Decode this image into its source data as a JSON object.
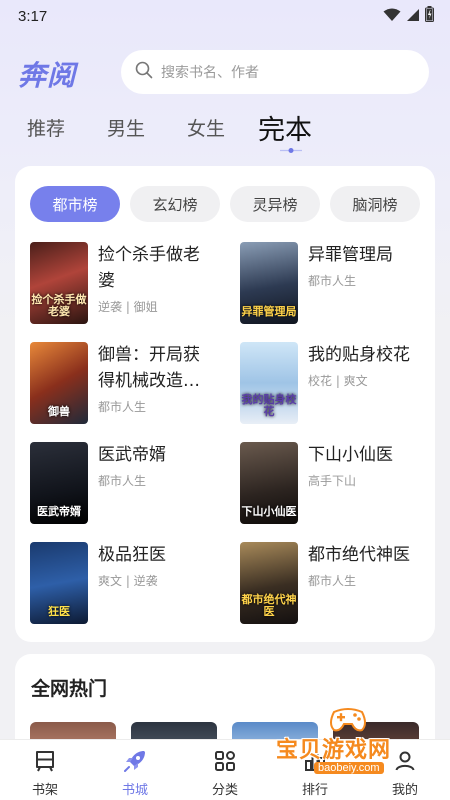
{
  "status_bar": {
    "time": "3:17",
    "icons": [
      "wifi-icon",
      "signal-icon",
      "battery-icon"
    ]
  },
  "header": {
    "logo": "奔阅",
    "search_placeholder": "搜索书名、作者"
  },
  "top_tabs": [
    "推荐",
    "男生",
    "女生",
    "完本"
  ],
  "active_top_tab": "完本",
  "chips": [
    "都市榜",
    "玄幻榜",
    "灵异榜",
    "脑洞榜"
  ],
  "active_chip": "都市榜",
  "books": [
    {
      "title": "捡个杀手做老婆",
      "meta": "逆袭 | 御姐",
      "cover_text": "捡个杀手做老婆"
    },
    {
      "title": "异罪管理局",
      "meta": "都市人生",
      "cover_text": "异罪管理局"
    },
    {
      "title": "御兽：开局获得机械改造…",
      "meta": "都市人生",
      "cover_text": "御兽"
    },
    {
      "title": "我的贴身校花",
      "meta": "校花 | 爽文",
      "cover_text": "我的贴身校花"
    },
    {
      "title": "医武帝婿",
      "meta": "都市人生",
      "cover_text": "医武帝婿"
    },
    {
      "title": "下山小仙医",
      "meta": "高手下山",
      "cover_text": "下山小仙医"
    },
    {
      "title": "极品狂医",
      "meta": "爽文 | 逆袭",
      "cover_text": "狂医"
    },
    {
      "title": "都市绝代神医",
      "meta": "都市人生",
      "cover_text": "都市绝代神医"
    }
  ],
  "section2": {
    "title": "全网热门"
  },
  "bottom_nav": [
    {
      "label": "书架",
      "icon": "bookshelf-icon"
    },
    {
      "label": "书城",
      "icon": "rocket-icon"
    },
    {
      "label": "分类",
      "icon": "category-icon"
    },
    {
      "label": "排行",
      "icon": "ranking-icon"
    },
    {
      "label": "我的",
      "icon": "profile-icon"
    }
  ],
  "active_nav": "书城",
  "watermark": {
    "text": "宝贝游戏网",
    "url": "baobeiy.com"
  },
  "colors": {
    "accent": "#6f78e6",
    "chip_active": "#7780ec",
    "watermark": "#f58a1f"
  }
}
